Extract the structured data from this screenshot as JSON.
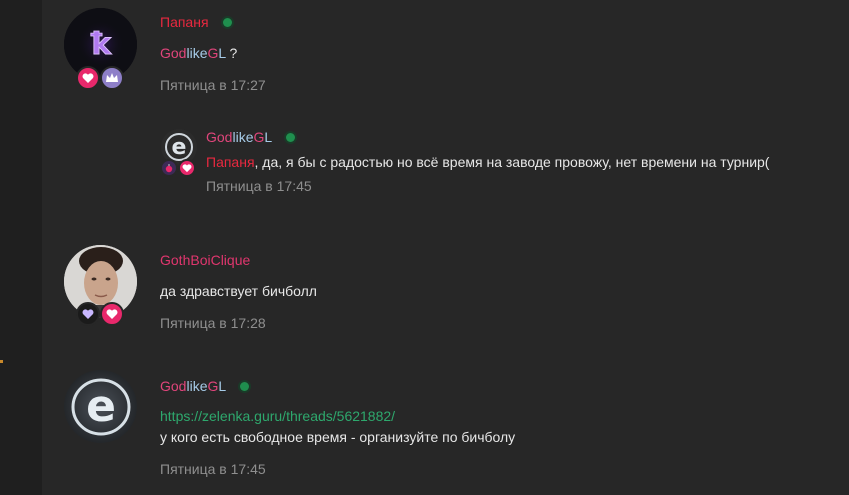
{
  "posts": [
    {
      "author": "Папаня",
      "author_color": "#e8283f",
      "online": true,
      "text_mention_parts": [
        "God",
        "like",
        "G",
        "L"
      ],
      "text_suffix": " ?",
      "time": "Пятница в 17:27",
      "badges": [
        "heart-badge",
        "crown-badge"
      ]
    },
    {
      "reply": true,
      "author_parts": [
        "God",
        "like",
        "G",
        "L"
      ],
      "online": true,
      "mention": "Папаня",
      "text": ", да, я бы с радостью но всё время на заводе провожу, нет времени на турнир(",
      "time": "Пятница в 17:45",
      "badges": [
        "bomb-badge",
        "heart-badge"
      ]
    },
    {
      "author": "GothBoiClique",
      "author_color": "#e0366e",
      "online": false,
      "text": "да здравствует бичболл",
      "time": "Пятница в 17:28",
      "badges": [
        "heart-badge-dark",
        "heart-badge"
      ]
    },
    {
      "author_parts": [
        "God",
        "like",
        "G",
        "L"
      ],
      "online": true,
      "link": "https://zelenka.guru/threads/5621882/",
      "text": "у кого есть свободное время - организуйте по бичболу",
      "time": "Пятница в 17:45"
    }
  ],
  "colors": {
    "background": "#272727",
    "side_panel": "#1f1f1f",
    "text": "#e7e7e7",
    "time": "#8f8f8f",
    "link": "#2ea86d",
    "online": "#1f8f4e",
    "gl_pink": "#e0457b",
    "gl_blue": "#a6cbe8"
  }
}
